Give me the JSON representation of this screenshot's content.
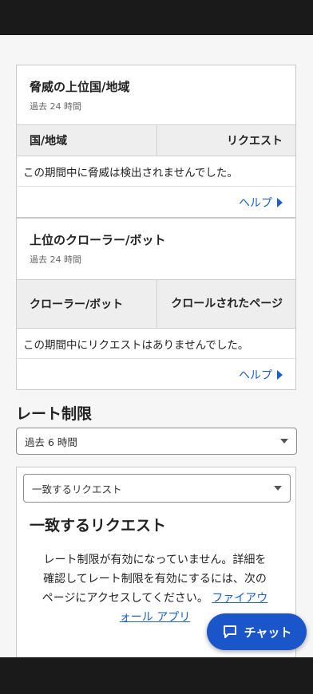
{
  "threats_card": {
    "title": "脅威の上位国/地域",
    "subtitle": "過去 24 時間",
    "col_left": "国/地域",
    "col_right": "リクエスト",
    "empty_message": "この期間中に脅威は検出されませんでした。",
    "help_label": "ヘルプ"
  },
  "crawlers_card": {
    "title": "上位のクローラー/ボット",
    "subtitle": "過去 24 時間",
    "col_left": "クローラー/ボット",
    "col_right": "クロールされたページ",
    "empty_message": "この期間中にリクエストはありませんでした。",
    "help_label": "ヘルプ"
  },
  "rate_limit": {
    "section_title": "レート制限",
    "period_select": "過去 6 時間",
    "filter_select": "一致するリクエスト",
    "heading": "一致するリクエスト",
    "message_text": "レート制限が有効になっていません。詳細を確認してレート制限を有効にするには、次のページにアクセスしてください。",
    "message_link": "ファイアウォール アプリ"
  },
  "chat": {
    "label": "チャット"
  },
  "icons": {
    "help_arrow": "caret-right-icon",
    "dropdown": "caret-down-icon",
    "chat": "chat-bubble-icon"
  },
  "colors": {
    "link": "#1a5fd1",
    "chat_button": "#1a56c9",
    "system_bar": "#1a1a1a"
  }
}
